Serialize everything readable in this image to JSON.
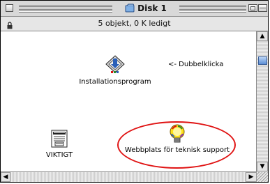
{
  "window": {
    "title": "Disk 1",
    "status": "5 objekt, 0 K ledigt"
  },
  "icons": [
    {
      "label": "Installationsprogram",
      "icon": "installer-icon"
    },
    {
      "label": "VIKTIGT",
      "icon": "document-icon"
    },
    {
      "label": "Webbplats för teknisk support",
      "icon": "lightbulb-icon"
    }
  ],
  "hint": "<- Dubbelklicka",
  "scrollbars": {
    "up_arrow": "▲",
    "down_arrow": "▼",
    "left_arrow": "◀",
    "right_arrow": "▶"
  },
  "colors": {
    "highlight_ellipse": "#e01414",
    "scroll_thumb": "#5d8fd6"
  }
}
